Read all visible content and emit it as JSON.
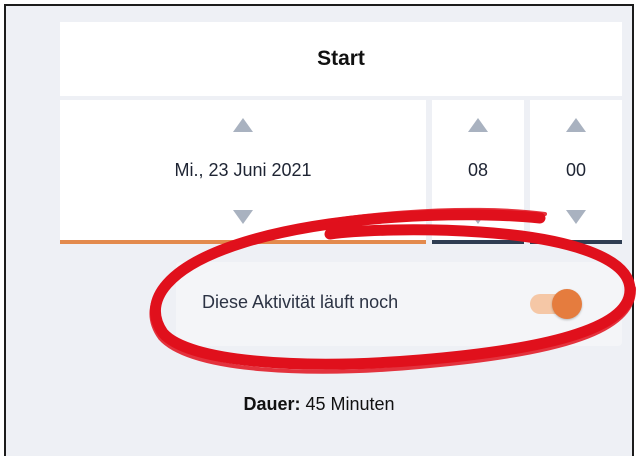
{
  "header": {
    "title": "Start"
  },
  "pickers": {
    "date": {
      "value": "Mi., 23 Juni 2021"
    },
    "hour": {
      "value": "08"
    },
    "minute": {
      "value": "00"
    }
  },
  "toggle": {
    "label": "Diese Aktivität läuft noch",
    "state": "on"
  },
  "duration": {
    "label": "Dauer:",
    "value": "45 Minuten"
  },
  "colors": {
    "accent": "#e57c3e",
    "accent_light": "#f5c7a6",
    "picker_underline": "#2f3d52",
    "annotation": "#e0101c",
    "background": "#eef0f5"
  }
}
